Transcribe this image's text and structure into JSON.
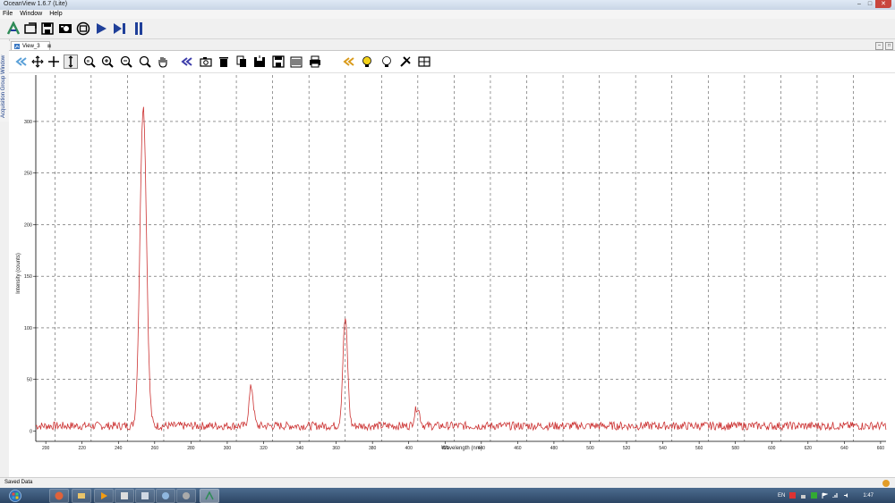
{
  "window": {
    "title": "OceanView 1.6.7 (Lite)"
  },
  "menu": {
    "items": [
      "File",
      "Window",
      "Help"
    ]
  },
  "main_toolbar": {
    "icons": [
      "acquisition-wizard-icon",
      "open-icon",
      "save-icon",
      "camera-search-icon",
      "device-icon",
      "play-icon",
      "single-step-icon",
      "pause-icon"
    ]
  },
  "side_panel": {
    "label": "Acquisition Group Window"
  },
  "view": {
    "tab_label": "View_3",
    "tab_close": "⊠"
  },
  "plot_toolbar": {
    "icons": [
      "collapse-left-icon",
      "pan-icon",
      "crosshair-icon",
      "y-cursor-icon",
      "zoom-fit-icon",
      "zoom-in-icon",
      "zoom-out-icon",
      "zoom-icon",
      "hand-icon",
      "back-icon",
      "snapshot-icon",
      "delete-icon",
      "copy-icon",
      "save-icon",
      "export-icon",
      "print-icon",
      "expand-icon",
      "bulb-on-icon",
      "bulb-off-icon",
      "tools-icon",
      "layout-icon"
    ]
  },
  "chart_data": {
    "type": "line",
    "title": "",
    "xlabel": "Wavelength (nm)",
    "ylabel": "Intensity (counts)",
    "xlim": [
      194.5,
      663
    ],
    "ylim": [
      -10,
      345
    ],
    "x_ticks": [
      200,
      220,
      240,
      260,
      280,
      300,
      320,
      340,
      360,
      380,
      400,
      420,
      440,
      460,
      480,
      500,
      520,
      540,
      560,
      580,
      600,
      620,
      640,
      660
    ],
    "y_ticks": [
      0,
      50,
      100,
      150,
      200,
      250,
      300
    ],
    "grid": true,
    "legend": "none",
    "series": [
      {
        "color": "#cc3333",
        "baseline": 5,
        "noise": 4,
        "peaks": [
          {
            "x": 253.7,
            "height": 310,
            "width": 1.8
          },
          {
            "x": 313.2,
            "height": 38,
            "width": 1.2
          },
          {
            "x": 365.0,
            "height": 104,
            "width": 1.3
          },
          {
            "x": 404.6,
            "height": 18,
            "width": 1.4
          }
        ]
      }
    ]
  },
  "status": {
    "text": "Saved Data"
  },
  "taskbar": {
    "lang": "EN",
    "time": "1:47"
  },
  "colors": {
    "accent": "#1f3f99",
    "trace": "#cc3333",
    "grid": "#555555"
  }
}
